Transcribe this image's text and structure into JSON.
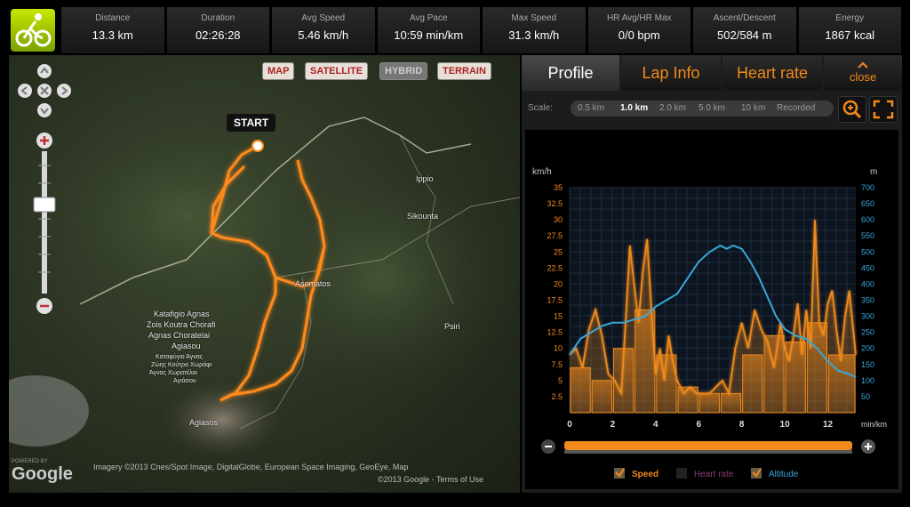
{
  "stats": [
    {
      "label": "Distance",
      "value": "13.3 km"
    },
    {
      "label": "Duration",
      "value": "02:26:28"
    },
    {
      "label": "Avg Speed",
      "value": "5.46 km/h"
    },
    {
      "label": "Avg Pace",
      "value": "10:59 min/km"
    },
    {
      "label": "Max Speed",
      "value": "31.3 km/h"
    },
    {
      "label": "HR Avg/HR Max",
      "value": "0/0 bpm"
    },
    {
      "label": "Ascent/Descent",
      "value": "502/584 m"
    },
    {
      "label": "Energy",
      "value": "1867 kcal"
    }
  ],
  "map": {
    "buttons": {
      "map": "MAP",
      "satellite": "SATELLITE",
      "hybrid": "HYBRID",
      "terrain": "TERRAIN"
    },
    "start": "START",
    "towns": {
      "ippio": "Ippio",
      "sikounta": "Sikounta",
      "mid": "Asomatos",
      "psiri": "Psiri",
      "agiasos": "Agiasos",
      "kat1": "Katafigio Agnas",
      "kat2": "Zois Koutra Chorafi",
      "kat3": "Agnas Choratelai",
      "kat4": "Agiasou",
      "kat5": "Καταφύγιο Άγνας",
      "kat6": "Ζώης Κούτρα Χωράφι",
      "kat7": "Άγνας Χωρατέλαι",
      "kat8": "Αγιάσου"
    },
    "attribution": "Imagery ©2013 Cnes/Spot Image, DigitalGlobe, European Space Imaging, GeoEye, Map",
    "attribution2": "©2013 Google - Terms of Use",
    "powered": "POWERED BY",
    "google": "Google"
  },
  "panel": {
    "tabs": [
      "Profile",
      "Lap Info",
      "Heart rate"
    ],
    "close": "close",
    "scale_label": "Scale:",
    "scale_options": [
      "0.5 km",
      "1.0 km",
      "2.0 km",
      "5.0 km",
      "10 km",
      "Recorded"
    ],
    "scale_selected": "1.0 km",
    "legend": {
      "speed": "Speed",
      "heart": "Heart rate",
      "altitude": "Altitude"
    }
  },
  "colors": {
    "speed": "#f08a1c",
    "altitude": "#38a8d8",
    "heart": "#c03aa0",
    "accent": "#f08a1c"
  },
  "chart_data": {
    "type": "line",
    "left_unit": "km/h",
    "right_unit": "m",
    "x_unit": "min/km",
    "x_ticks": [
      0,
      2,
      4,
      6,
      8,
      10,
      12
    ],
    "xlim": [
      0,
      13.3
    ],
    "speed_ticks": [
      2.5,
      5,
      7.5,
      10,
      12.5,
      15,
      17.5,
      20,
      22.5,
      25,
      27.5,
      30,
      32.5,
      35
    ],
    "speed_lim": [
      0,
      35
    ],
    "altitude_ticks": [
      50,
      100,
      150,
      200,
      250,
      300,
      350,
      400,
      450,
      500,
      550,
      600,
      650,
      700
    ],
    "altitude_lim": [
      0,
      700
    ],
    "series": [
      {
        "name": "Speed",
        "axis": "left",
        "x": [
          0,
          0.3,
          0.6,
          0.9,
          1.2,
          1.5,
          1.8,
          2.1,
          2.4,
          2.6,
          2.8,
          3.0,
          3.2,
          3.4,
          3.6,
          3.8,
          4.0,
          4.2,
          4.4,
          4.6,
          4.8,
          5.0,
          5.3,
          5.6,
          5.9,
          6.2,
          6.5,
          6.8,
          7.1,
          7.4,
          7.7,
          8.0,
          8.3,
          8.6,
          8.9,
          9.2,
          9.5,
          9.8,
          10.0,
          10.2,
          10.4,
          10.6,
          10.8,
          11.0,
          11.2,
          11.4,
          11.6,
          11.8,
          12.0,
          12.2,
          12.4,
          12.6,
          12.8,
          13.0,
          13.3
        ],
        "values": [
          9,
          10,
          7,
          13,
          16,
          12,
          6,
          5,
          3,
          14,
          26,
          20,
          14,
          22,
          27,
          16,
          6,
          10,
          5,
          12,
          8,
          5,
          3,
          4,
          3,
          3,
          3,
          4,
          5,
          3,
          10,
          14,
          10,
          16,
          13,
          11,
          7,
          14,
          10,
          8,
          12,
          17,
          9,
          16,
          10,
          30,
          14,
          12,
          17,
          19,
          13,
          8,
          15,
          19,
          9
        ]
      },
      {
        "name": "Altitude",
        "axis": "right",
        "x": [
          0,
          0.5,
          1.0,
          1.5,
          2.0,
          2.5,
          3.0,
          3.5,
          4.0,
          4.5,
          5.0,
          5.5,
          6.0,
          6.5,
          7.0,
          7.3,
          7.6,
          8.0,
          8.4,
          8.8,
          9.2,
          9.6,
          10.0,
          10.5,
          11.0,
          11.5,
          12.0,
          12.5,
          13.0,
          13.3
        ],
        "values": [
          180,
          230,
          250,
          270,
          280,
          280,
          290,
          300,
          330,
          350,
          370,
          420,
          470,
          500,
          520,
          510,
          520,
          510,
          470,
          420,
          360,
          300,
          260,
          240,
          230,
          200,
          160,
          130,
          120,
          110
        ]
      }
    ],
    "steps": [
      {
        "x0": 0,
        "x1": 1,
        "v": 7
      },
      {
        "x0": 1,
        "x1": 2,
        "v": 5
      },
      {
        "x0": 2,
        "x1": 3,
        "v": 10
      },
      {
        "x0": 3,
        "x1": 4,
        "v": 16
      },
      {
        "x0": 4,
        "x1": 5,
        "v": 9
      },
      {
        "x0": 5,
        "x1": 6,
        "v": 4
      },
      {
        "x0": 6,
        "x1": 7,
        "v": 3
      },
      {
        "x0": 7,
        "x1": 8,
        "v": 3
      },
      {
        "x0": 8,
        "x1": 9,
        "v": 9
      },
      {
        "x0": 9,
        "x1": 10,
        "v": 12
      },
      {
        "x0": 10,
        "x1": 11,
        "v": 11
      },
      {
        "x0": 11,
        "x1": 12,
        "v": 14
      },
      {
        "x0": 12,
        "x1": 13.3,
        "v": 9
      }
    ]
  }
}
